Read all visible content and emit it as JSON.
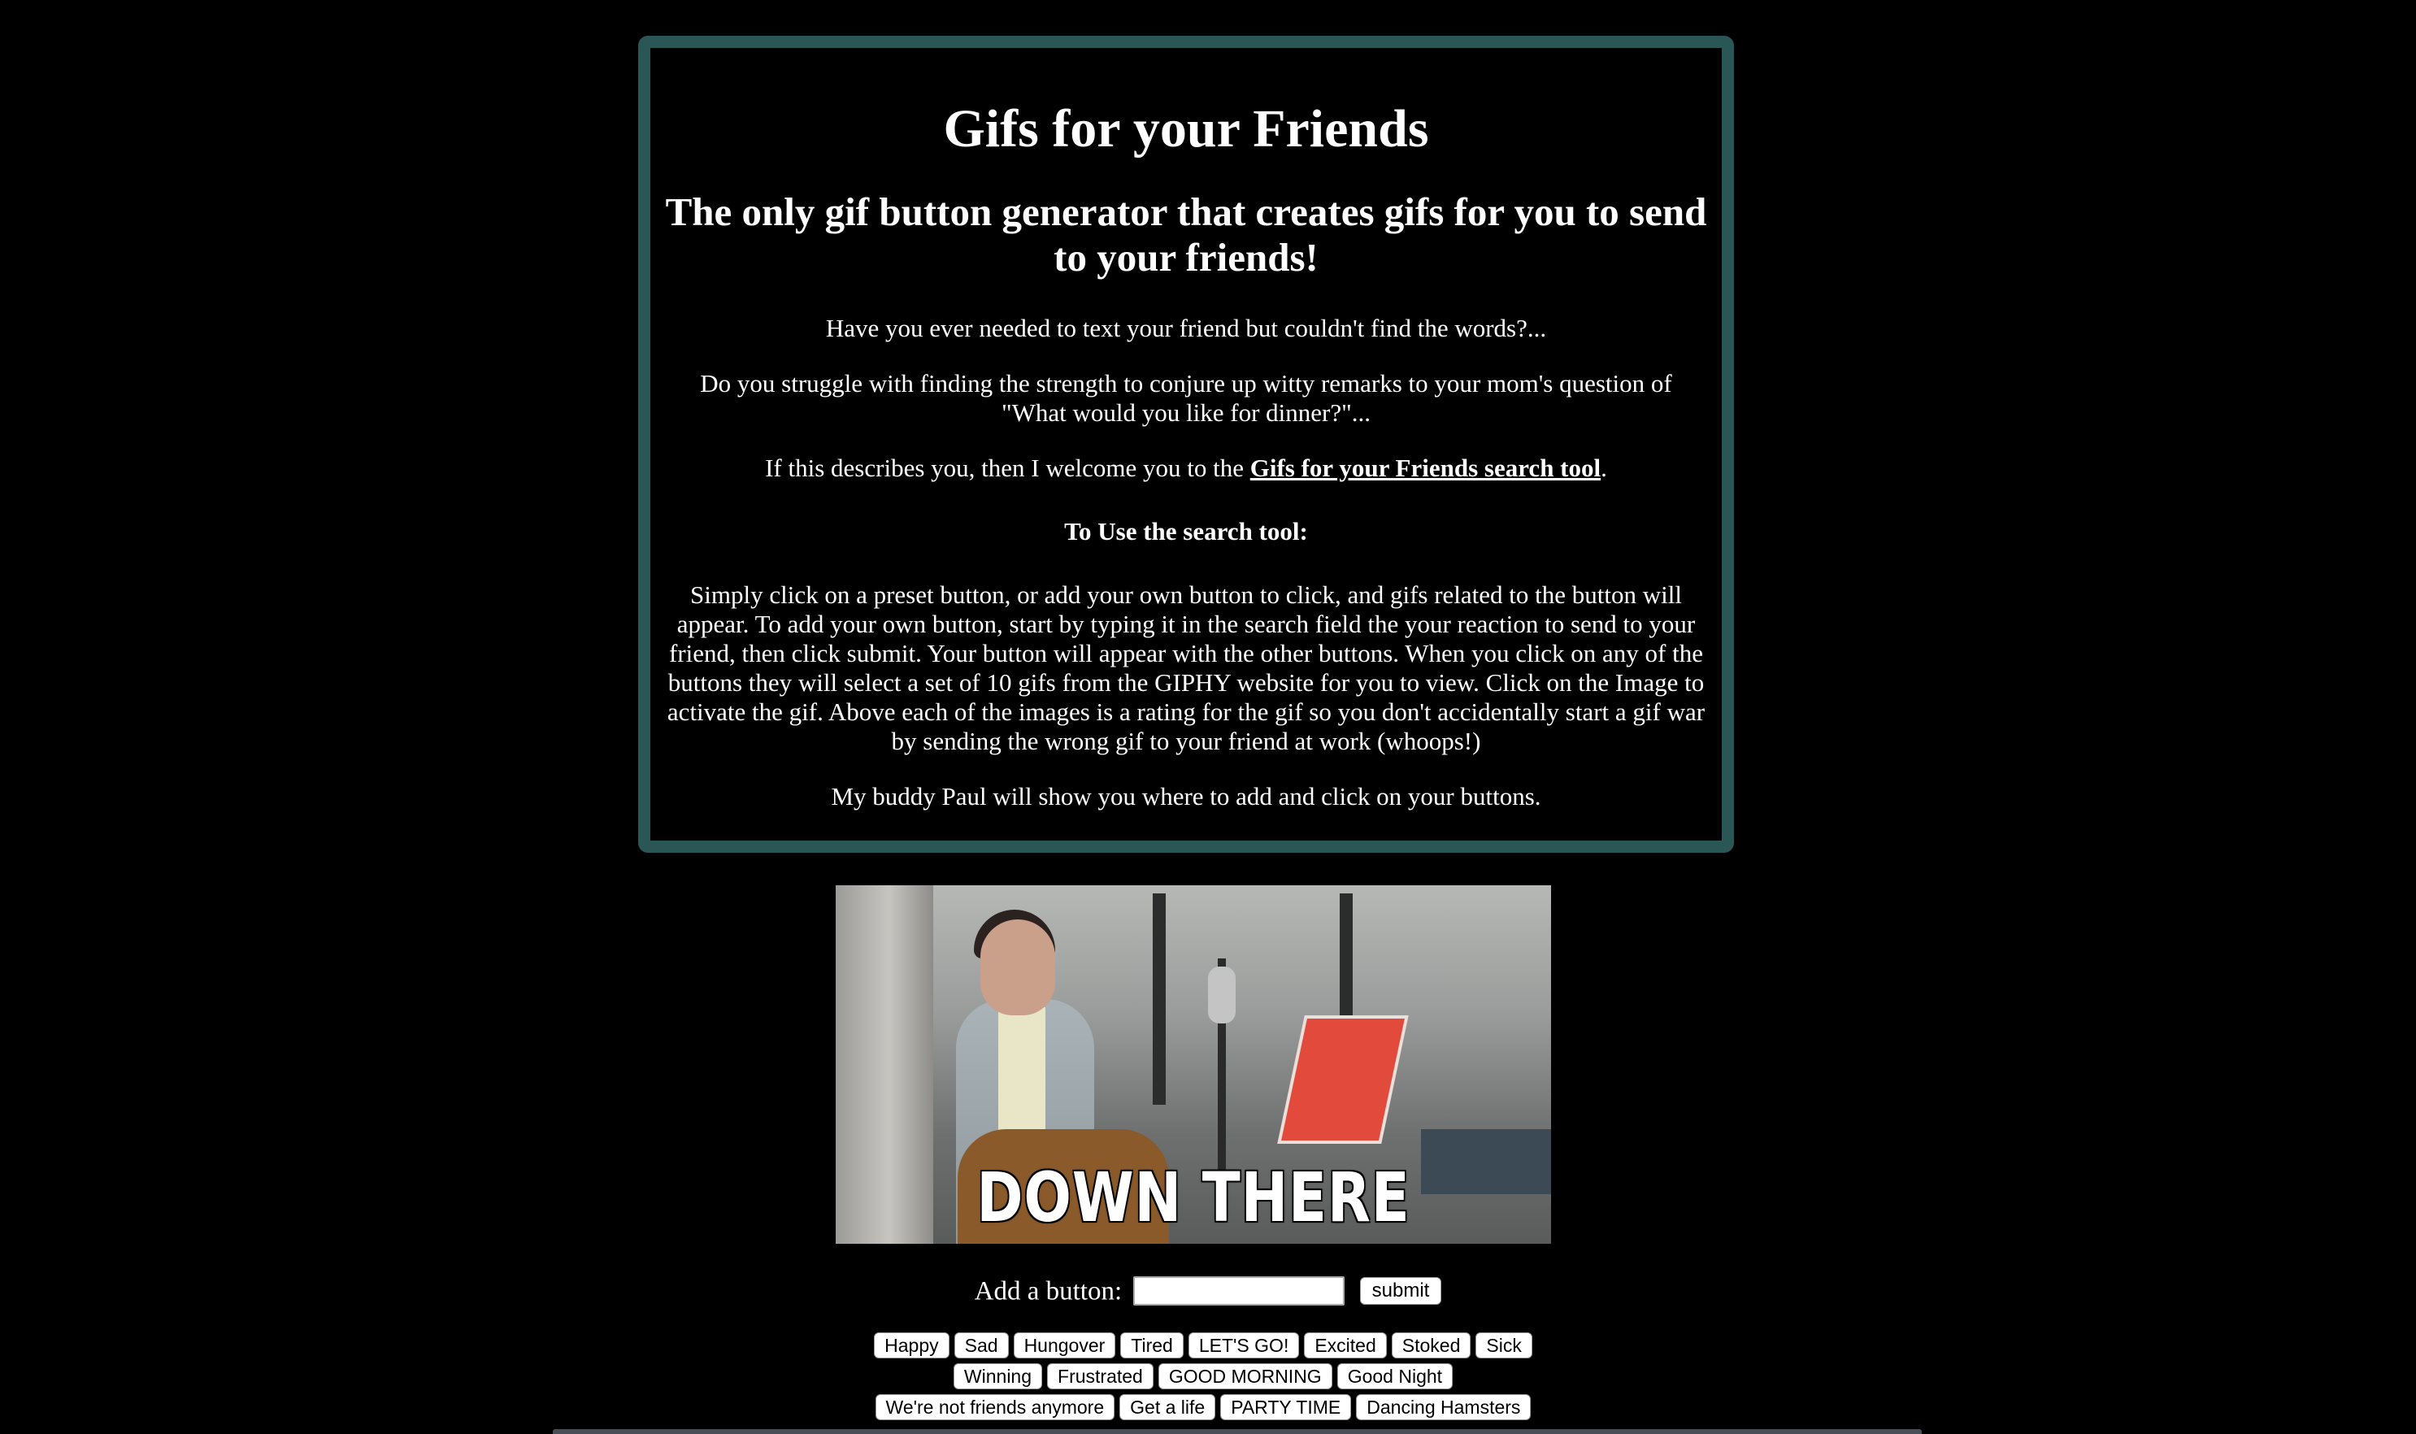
{
  "header": {
    "title": "Gifs for your Friends",
    "subtitle": "The only gif button generator that creates gifs for you to send to your friends!"
  },
  "intro": {
    "p1": "Have you ever needed to text your friend but couldn't find the words?...",
    "p2": "Do you struggle with finding the strength to conjure up witty remarks to your mom's question of \"What would you like for dinner?\"...",
    "p3_before": "If this describes you, then I welcome you to the ",
    "p3_link": "Gifs for your Friends search tool",
    "p3_after": ".",
    "how_to_heading": "To Use the search tool:",
    "instructions": "Simply click on a preset button, or add your own button to click, and gifs related to the button will appear. To add your own button, start by typing it in the search field the your reaction to send to your friend, then click submit. Your button will appear with the other buttons. When you click on any of the buttons they will select a set of 10 gifs from the GIPHY website for you to view. Click on the Image to activate the gif. Above each of the images is a rating for the gif so you don't accidentally start a gif war by sending the wrong gif to your friend at work (whoops!)",
    "closing": "My buddy Paul will show you where to add and click on your buttons."
  },
  "hero_gif": {
    "caption": "DOWN THERE"
  },
  "add_form": {
    "label": "Add a button:",
    "input_value": "",
    "submit_label": "submit"
  },
  "buttons": {
    "row1": [
      "Happy",
      "Sad",
      "Hungover",
      "Tired",
      "LET'S GO!",
      "Excited",
      "Stoked",
      "Sick"
    ],
    "row2": [
      "Winning",
      "Frustrated",
      "GOOD MORNING",
      "Good Night"
    ],
    "row3": [
      "We're not friends anymore",
      "Get a life",
      "PARTY TIME",
      "Dancing Hamsters"
    ]
  },
  "colors": {
    "background": "#000000",
    "card_border": "#2b5656",
    "text": "#ffffff",
    "button_bg": "#ffffff"
  }
}
